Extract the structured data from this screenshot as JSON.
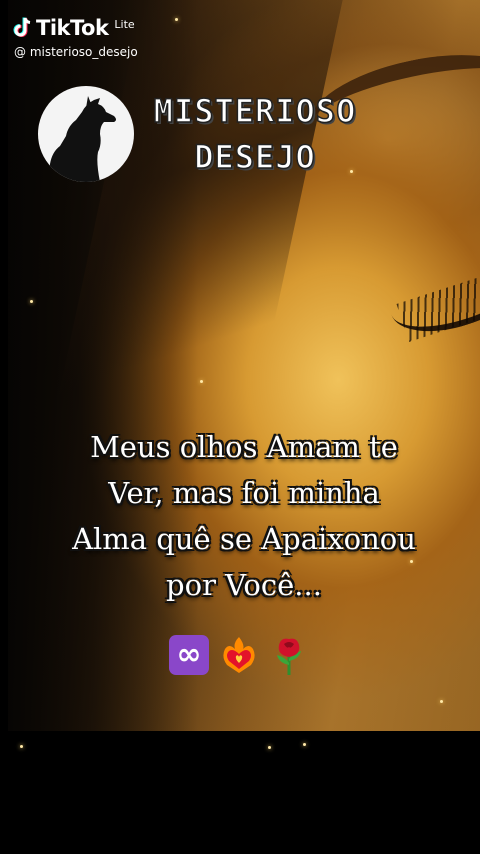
{
  "app": {
    "name": "TikTok",
    "edition": "Lite",
    "username": "@ misterioso_desejo"
  },
  "brand": {
    "line1": "MISTERIOSO",
    "line2": "DESEJO"
  },
  "quote": {
    "lines": [
      "Meus olhos Amam te",
      "Ver, mas foi minha",
      "Alma quê se Apaixonou",
      "por Você..."
    ]
  },
  "emojis": [
    {
      "icon": "infinity-icon",
      "color": "#8a47c9"
    },
    {
      "icon": "heart-on-fire-icon",
      "color": "#ff6a00"
    },
    {
      "icon": "rose-icon",
      "color": "#d0112b"
    }
  ],
  "colors": {
    "background": "#000000",
    "glow": "#f0c25a",
    "text": "#ffffff"
  }
}
